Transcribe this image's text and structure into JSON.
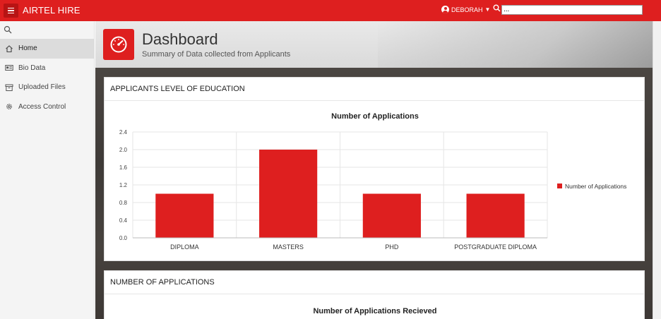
{
  "app": {
    "title": "AIRTEL HIRE"
  },
  "header": {
    "user": "DEBORAH",
    "search_value": "..."
  },
  "sidebar": {
    "items": [
      {
        "label": "Home",
        "icon": "home-icon",
        "active": true
      },
      {
        "label": "Bio Data",
        "icon": "id-card-icon",
        "active": false
      },
      {
        "label": "Uploaded Files",
        "icon": "archive-icon",
        "active": false
      },
      {
        "label": "Access Control",
        "icon": "gear-icon",
        "active": false
      }
    ]
  },
  "hero": {
    "title": "Dashboard",
    "subtitle": "Summary of Data collected from Applicants"
  },
  "cards": [
    {
      "heading": "APPLICANTS LEVEL OF EDUCATION",
      "chart_title": "Number of Applications"
    },
    {
      "heading": "NUMBER OF APPLICATIONS",
      "chart_title": "Number of Applications Recieved"
    }
  ],
  "colors": {
    "brand": "#de1f1f",
    "bar": "#de1f1f"
  },
  "chart_data": {
    "type": "bar",
    "title": "Number of Applications",
    "categories": [
      "DIPLOMA",
      "MASTERS",
      "PHD",
      "POSTGRADUATE DIPLOMA"
    ],
    "series": [
      {
        "name": "Number of Applications",
        "values": [
          1,
          2,
          1,
          1
        ]
      }
    ],
    "yticks": [
      "0.0",
      "0.4",
      "0.8",
      "1.2",
      "1.6",
      "2.0",
      "2.4"
    ],
    "ylim": [
      0,
      2.4
    ],
    "grid": true,
    "legend": "right"
  }
}
